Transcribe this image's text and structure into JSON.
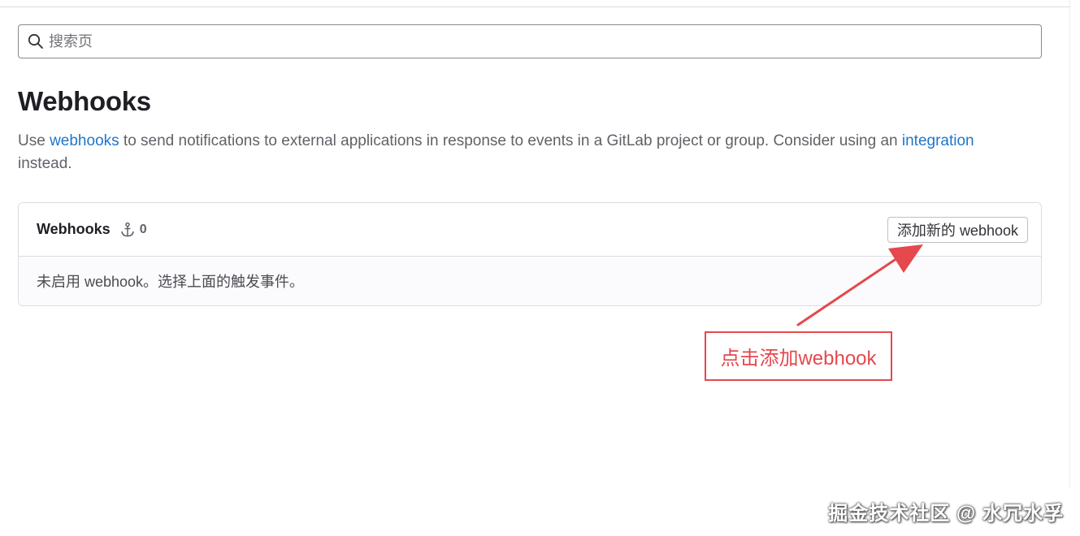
{
  "search": {
    "placeholder": "搜索页"
  },
  "page": {
    "title": "Webhooks",
    "description": {
      "part1": "Use ",
      "link1": "webhooks",
      "part2": " to send notifications to external applications in response to events in a GitLab project or group. Consider using an ",
      "link2": "integration",
      "part3": " instead."
    }
  },
  "card": {
    "title": "Webhooks",
    "count": "0",
    "count_icon": "anchor-icon",
    "add_button_label": "添加新的 webhook",
    "empty_message": "未启用 webhook。选择上面的触发事件。"
  },
  "annotation": {
    "callout_text": "点击添加webhook",
    "color": "#e5484d"
  },
  "watermark": "掘金技术社区 @ 水冗水孚",
  "colors": {
    "link": "#1f75cb",
    "border": "#dcdcde",
    "accent_red": "#e5484d"
  }
}
